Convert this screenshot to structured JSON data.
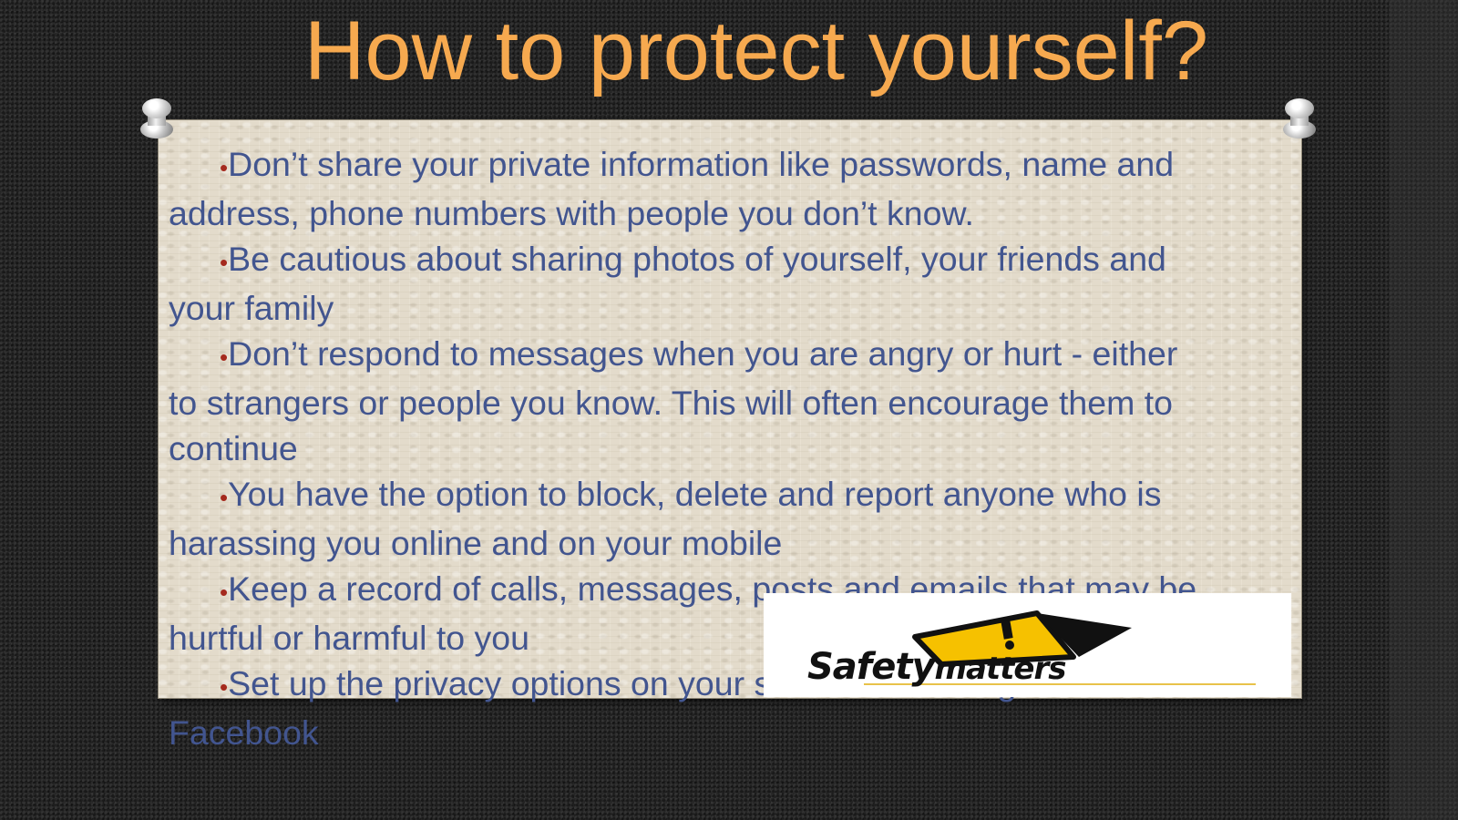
{
  "slide": {
    "title": "How to protect yourself?"
  },
  "colors": {
    "title": "#F6A94F",
    "body_text": "#42558F",
    "bullet": "#A52A1E",
    "card": "#E3DBCB",
    "background": "#262626"
  },
  "bullets": [
    {
      "marker": "•",
      "text": "Don’t share your private information like passwords, name and address, phone numbers with people you don’t know."
    },
    {
      "marker": "•",
      "text": "Be cautious about sharing photos of yourself, your friends and your family"
    },
    {
      "marker": "•",
      "text": "Don’t respond to messages when you are angry or hurt - either to strangers or people you know. This will often encourage them to continue"
    },
    {
      "marker": "•",
      "text": "You have the option to block, delete and report anyone who is harassing you online and on your mobile"
    },
    {
      "marker": "•",
      "text": "Keep a record of calls, messages, posts and emails that may be hurtful or harmful to you"
    },
    {
      "marker": "•",
      "text": "Set up the privacy options on your social networking sites like Facebook"
    }
  ],
  "logo": {
    "word1": "Safety",
    "word2": "matters",
    "icon": "warning-triangle-icon"
  }
}
